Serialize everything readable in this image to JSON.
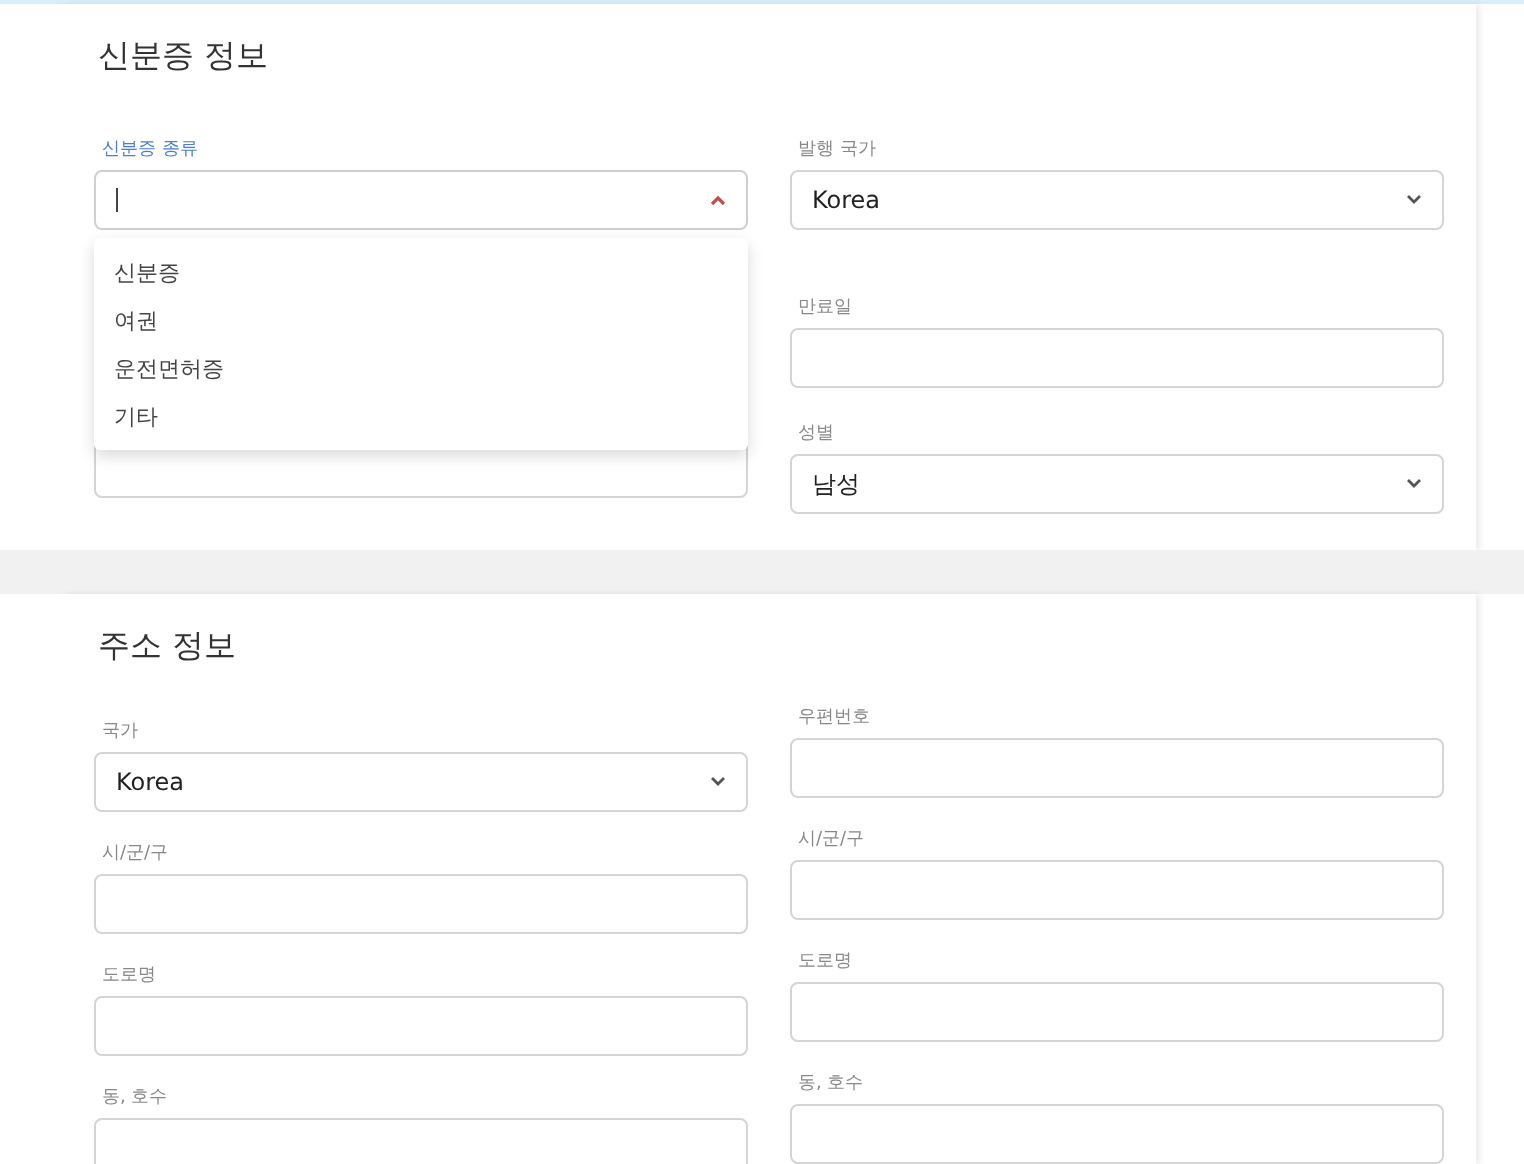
{
  "sections": [
    {
      "title": "신분증 정보",
      "columns": [
        [
          {
            "kind": "combobox",
            "label": "신분증 종류",
            "focused": true,
            "expanded": true,
            "options": [
              "신분증",
              "여권",
              "운전면허증",
              "기타"
            ]
          },
          {
            "kind": "textarea"
          }
        ],
        [
          {
            "kind": "select",
            "label": "발행 국가",
            "value": "Korea"
          },
          {
            "kind": "input",
            "label": "만료일"
          },
          {
            "kind": "select",
            "label": "성별",
            "value": "남성"
          }
        ]
      ]
    },
    {
      "title": "주소 정보",
      "columns": [
        [
          {
            "kind": "select",
            "label": "국가",
            "value": "Korea"
          },
          {
            "kind": "input",
            "label": "시/군/구"
          },
          {
            "kind": "input",
            "label": "도로명"
          },
          {
            "kind": "input",
            "label": "동, 호수"
          }
        ],
        [
          {
            "kind": "input",
            "label": "우편번호"
          },
          {
            "kind": "input",
            "label": "시/군/구"
          },
          {
            "kind": "input",
            "label": "도로명"
          },
          {
            "kind": "input",
            "label": "동, 호수"
          }
        ]
      ]
    }
  ]
}
